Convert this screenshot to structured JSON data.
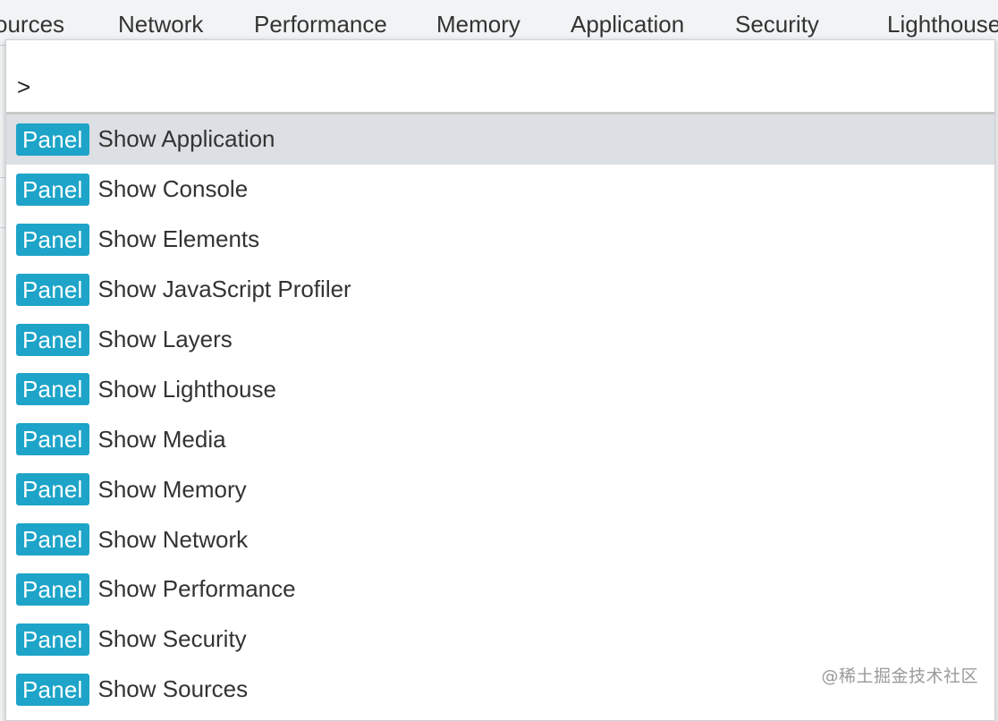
{
  "tabs": [
    {
      "label": "ources"
    },
    {
      "label": "Network"
    },
    {
      "label": "Performance"
    },
    {
      "label": "Memory"
    },
    {
      "label": "Application"
    },
    {
      "label": "Security"
    },
    {
      "label": "Lighthouse"
    }
  ],
  "command_palette": {
    "input_value": ">",
    "selected_index": 0,
    "items": [
      {
        "badge": "Panel",
        "label": "Show Application"
      },
      {
        "badge": "Panel",
        "label": "Show Console"
      },
      {
        "badge": "Panel",
        "label": "Show Elements"
      },
      {
        "badge": "Panel",
        "label": "Show JavaScript Profiler"
      },
      {
        "badge": "Panel",
        "label": "Show Layers"
      },
      {
        "badge": "Panel",
        "label": "Show Lighthouse"
      },
      {
        "badge": "Panel",
        "label": "Show Media"
      },
      {
        "badge": "Panel",
        "label": "Show Memory"
      },
      {
        "badge": "Panel",
        "label": "Show Network"
      },
      {
        "badge": "Panel",
        "label": "Show Performance"
      },
      {
        "badge": "Panel",
        "label": "Show Security"
      },
      {
        "badge": "Panel",
        "label": "Show Sources"
      }
    ]
  },
  "colors": {
    "badge_background": "#1da4c8",
    "selected_row": "#dcdfe3",
    "tab_strip": "#f1f3f4"
  },
  "watermark": "@稀土掘金技术社区"
}
